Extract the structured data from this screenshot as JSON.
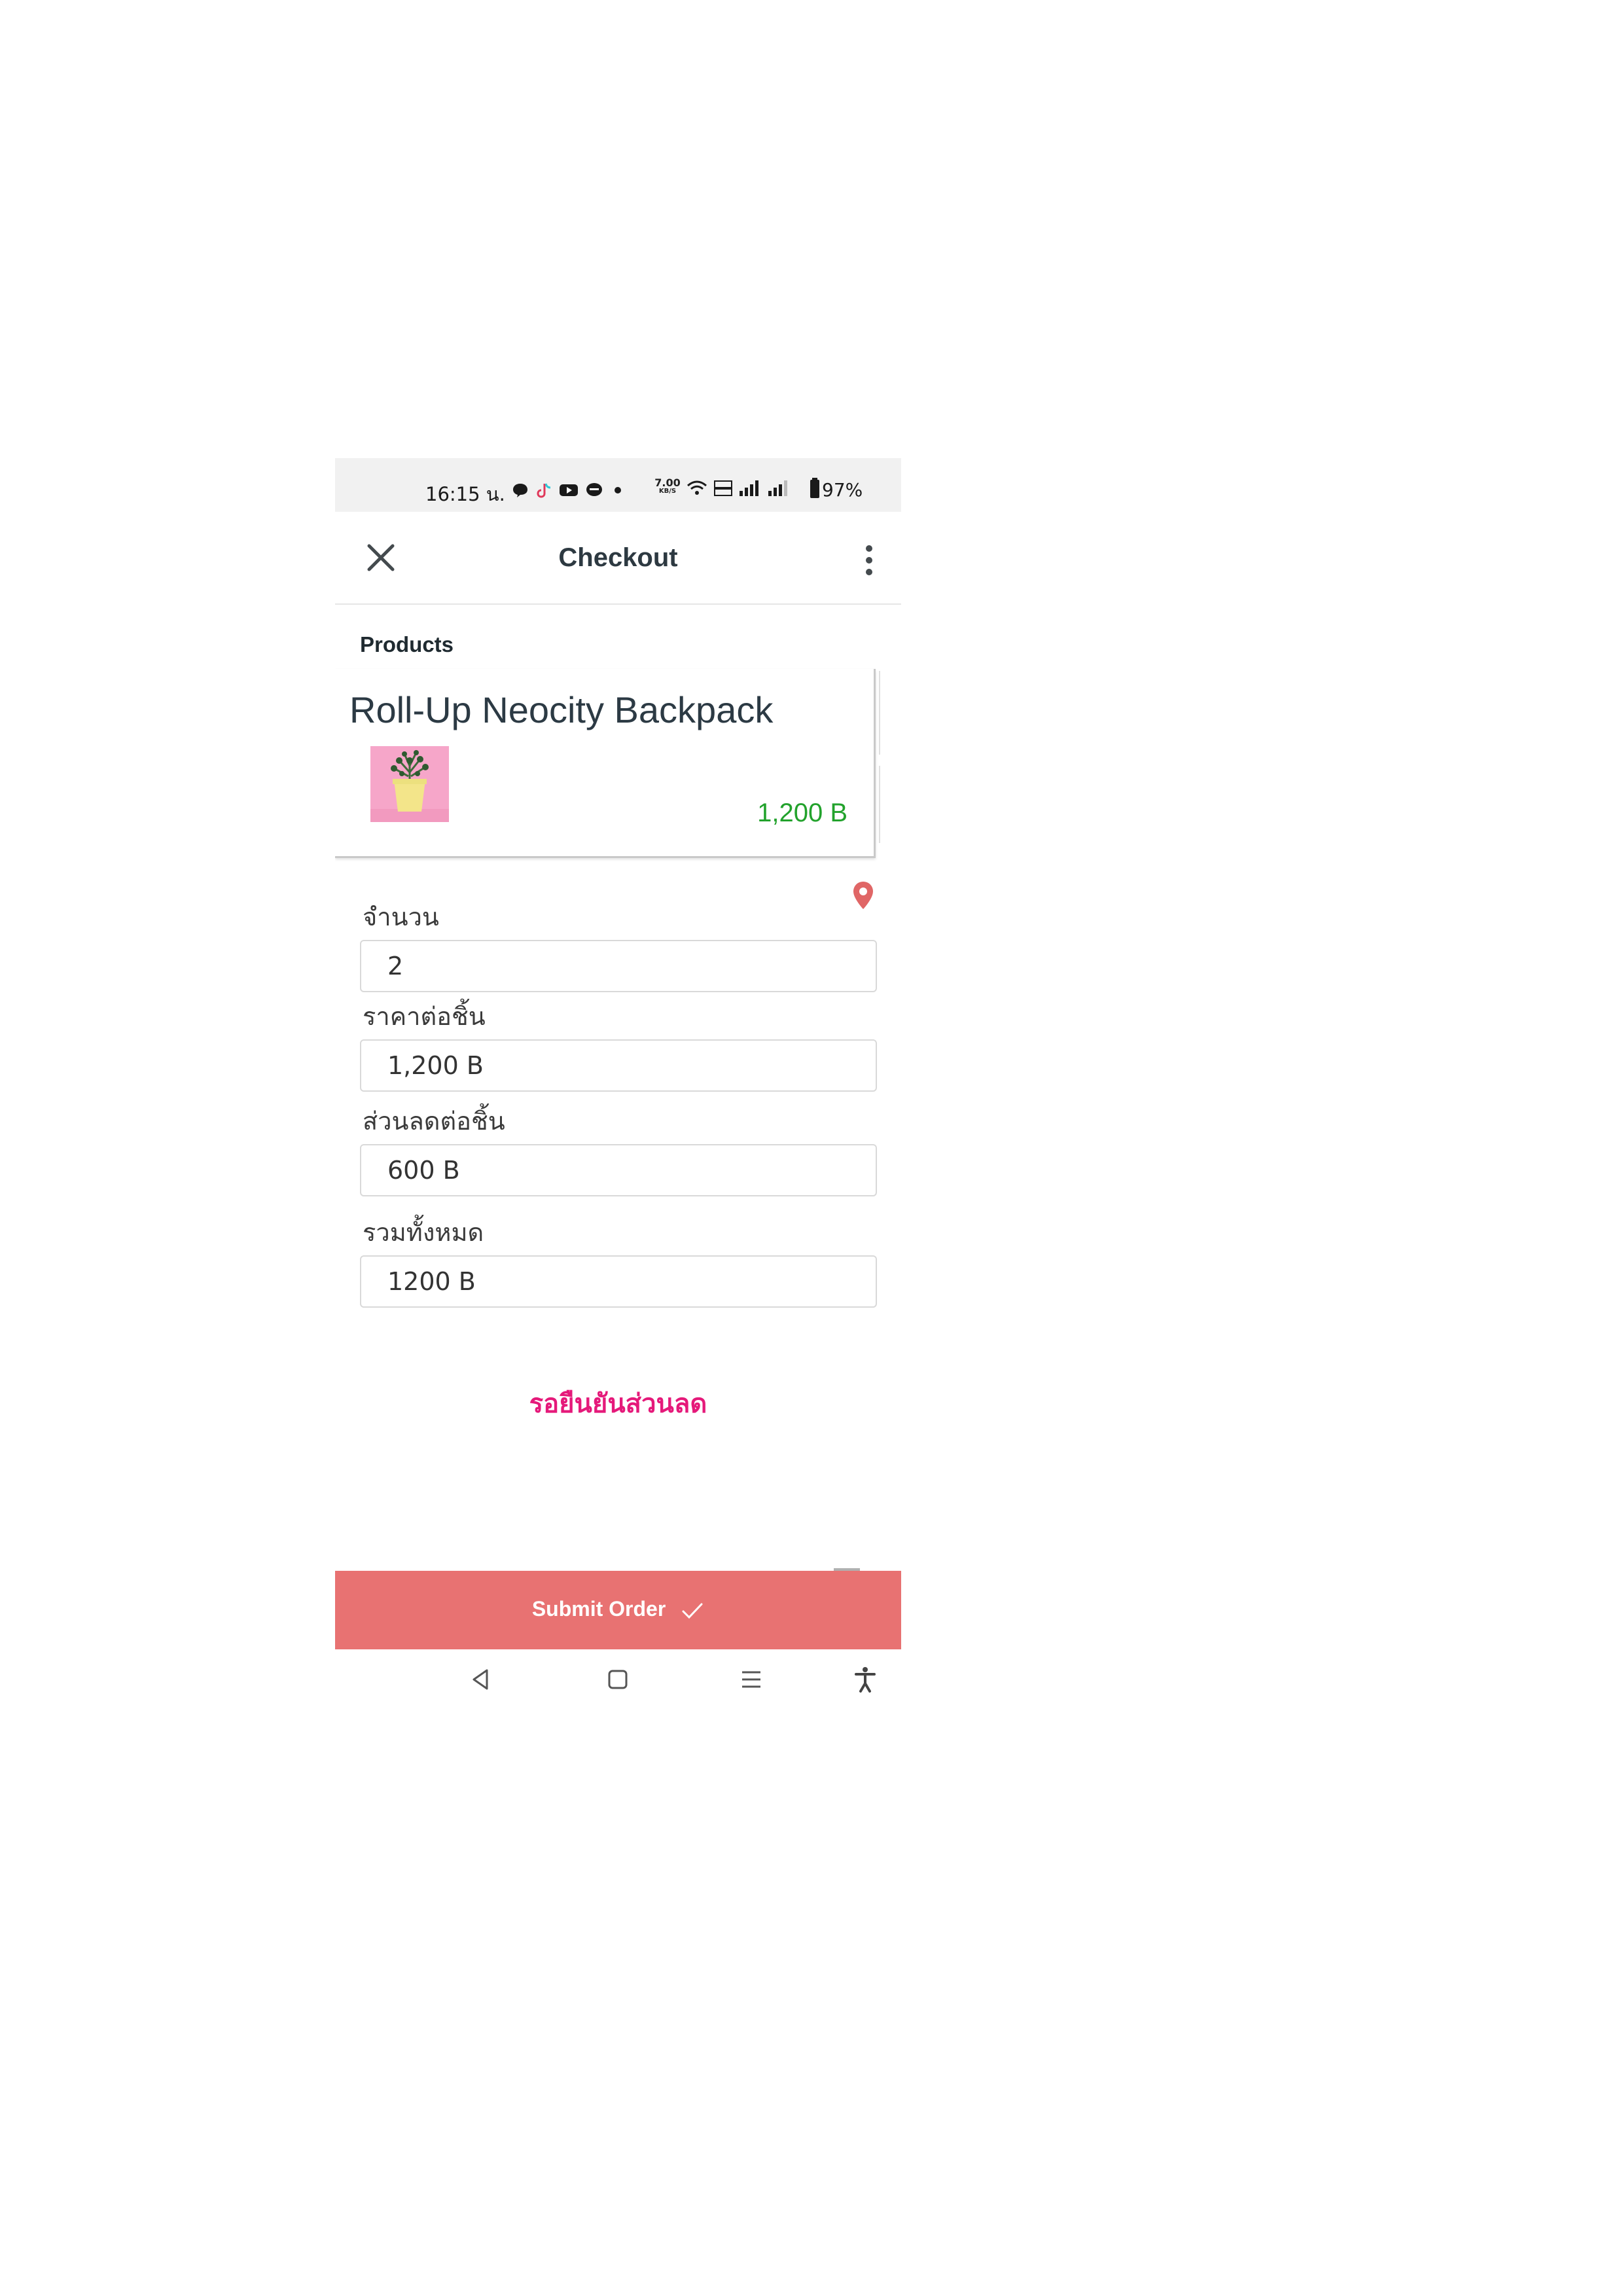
{
  "status_bar": {
    "time": "16:15 น.",
    "net_speed_value": "7.00",
    "net_speed_unit": "KB/S",
    "battery": "97%"
  },
  "app_bar": {
    "title": "Checkout",
    "close_icon": "close-icon",
    "more_icon": "more-vertical-icon"
  },
  "products": {
    "section_label": "Products",
    "items": [
      {
        "name": "Roll-Up Neocity Backpack",
        "price": "1,200 B",
        "image": "potted-plant-image"
      }
    ]
  },
  "form": {
    "quantity_label": "จำนวน",
    "quantity_value": "2",
    "unit_price_label": "ราคาต่อชิ้น",
    "unit_price_value": "1,200 B",
    "discount_label": "ส่วนลดต่อชิ้น",
    "discount_value": "600 B",
    "total_label": "รวมทั้งหมด",
    "total_value": "1200 B"
  },
  "status_message": "รอยืนยันส่วนลด",
  "submit": {
    "label": "Submit Order"
  },
  "colors": {
    "accent": "#e87272",
    "price_green": "#22a22c",
    "status_pink": "#e5197a",
    "pin_red": "#e06666"
  }
}
